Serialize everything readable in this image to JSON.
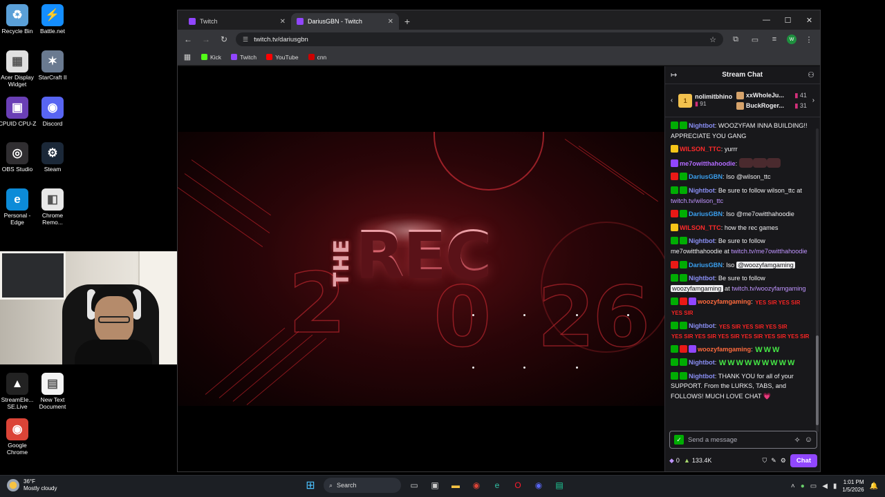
{
  "desktop": {
    "icons": [
      {
        "label": "Recycle Bin",
        "glyph": "♻",
        "color": "#5aa0d8"
      },
      {
        "label": "Battle.net",
        "glyph": "⚡",
        "color": "#148eff"
      },
      {
        "label": "Acer Display Widget",
        "glyph": "▦",
        "color": "#e0e0e0"
      },
      {
        "label": "StarCraft II",
        "glyph": "✶",
        "color": "#6a7a90"
      },
      {
        "label": "CPUID CPU-Z",
        "glyph": "▣",
        "color": "#6a3fb5"
      },
      {
        "label": "Discord",
        "glyph": "◉",
        "color": "#5865f2"
      },
      {
        "label": "OBS Studio",
        "glyph": "◎",
        "color": "#302e31"
      },
      {
        "label": "Steam",
        "glyph": "⚙",
        "color": "#1b2838"
      },
      {
        "label": "Personal - Edge",
        "glyph": "e",
        "color": "#0c8bd8"
      },
      {
        "label": "Chrome Remo...",
        "glyph": "◧",
        "color": "#e8e8e8"
      },
      {
        "label": "StreamEle... SE.Live",
        "glyph": "▲",
        "color": "#222"
      },
      {
        "label": "New Text Document",
        "glyph": "▤",
        "color": "#f4f4f4"
      },
      {
        "label": "Google Chrome",
        "glyph": "◉",
        "color": "#db4437"
      }
    ]
  },
  "browser": {
    "tabs": [
      {
        "label": "Twitch",
        "active": false
      },
      {
        "label": "DariusGBN - Twitch",
        "active": true
      }
    ],
    "url": "twitch.tv/dariusgbn",
    "profile_initial": "W",
    "bookmarks": [
      {
        "label": "Kick",
        "color": "#53fc18"
      },
      {
        "label": "Twitch",
        "color": "#9146ff"
      },
      {
        "label": "YouTube",
        "color": "#ff0000"
      },
      {
        "label": "cnn",
        "color": "#cc0000"
      }
    ]
  },
  "stream": {
    "title_small": "THE",
    "title_big": "REC",
    "year_digits": [
      "2",
      "0",
      "2",
      "6"
    ]
  },
  "chat": {
    "header": "Stream Chat",
    "gifters": {
      "top": {
        "name": "nolimitbhino",
        "count": "91",
        "rank": "1"
      },
      "others": [
        {
          "name": "xxWholeJu...",
          "count": "41"
        },
        {
          "name": "BuckRoger...",
          "count": "31"
        }
      ]
    },
    "messages": [
      {
        "user": "Nightbot",
        "color": "#8a8ff5",
        "badges": [
          "#00ad03",
          "#00ad03"
        ],
        "parts": [
          {
            "t": "text",
            "v": "WOOZYFAM INNA BUILDING!! APPRECIATE YOU GANG"
          }
        ]
      },
      {
        "user": "WILSON_TTC",
        "color": "#ff2a2a",
        "badges": [
          "#f5c518"
        ],
        "parts": [
          {
            "t": "text",
            "v": "yurrr"
          }
        ]
      },
      {
        "user": "me7owitthahoodie",
        "color": "#b36bff",
        "badges": [
          "#9146ff"
        ],
        "parts": [
          {
            "t": "face",
            "v": ""
          },
          {
            "t": "face",
            "v": ""
          },
          {
            "t": "face",
            "v": ""
          }
        ]
      },
      {
        "user": "DariusGBN",
        "color": "#3aa0f0",
        "badges": [
          "#e91916",
          "#00ad03"
        ],
        "parts": [
          {
            "t": "text",
            "v": "Iso @wilson_ttc"
          }
        ]
      },
      {
        "user": "Nightbot",
        "color": "#8a8ff5",
        "badges": [
          "#00ad03",
          "#00ad03"
        ],
        "parts": [
          {
            "t": "text",
            "v": "Be sure to follow wilson_ttc at "
          },
          {
            "t": "link",
            "v": "twitch.tv/wilson_ttc"
          }
        ]
      },
      {
        "user": "DariusGBN",
        "color": "#3aa0f0",
        "badges": [
          "#e91916",
          "#00ad03"
        ],
        "parts": [
          {
            "t": "text",
            "v": "Iso @me7owitthahoodie"
          }
        ]
      },
      {
        "user": "WILSON_TTC",
        "color": "#ff2a2a",
        "badges": [
          "#f5c518"
        ],
        "parts": [
          {
            "t": "text",
            "v": "how the rec games"
          }
        ]
      },
      {
        "user": "Nightbot",
        "color": "#8a8ff5",
        "badges": [
          "#00ad03",
          "#00ad03"
        ],
        "parts": [
          {
            "t": "text",
            "v": "Be sure to follow me7owitthahoodie at "
          },
          {
            "t": "link",
            "v": "twitch.tv/me7owitthahoodie"
          }
        ]
      },
      {
        "user": "DariusGBN",
        "color": "#3aa0f0",
        "badges": [
          "#e91916",
          "#00ad03"
        ],
        "parts": [
          {
            "t": "text",
            "v": "Iso "
          },
          {
            "t": "mention",
            "v": "@woozyfamgaming"
          }
        ]
      },
      {
        "user": "Nightbot",
        "color": "#8a8ff5",
        "badges": [
          "#00ad03",
          "#00ad03"
        ],
        "parts": [
          {
            "t": "text",
            "v": "Be sure to follow "
          },
          {
            "t": "mention",
            "v": "woozyfamgaming"
          },
          {
            "t": "text",
            "v": " at "
          },
          {
            "t": "link",
            "v": "twitch.tv/woozyfamgaming"
          }
        ]
      },
      {
        "user": "woozyfamgaming",
        "color": "#ff6a3d",
        "badges": [
          "#00ad03",
          "#e91916",
          "#9146ff"
        ],
        "parts": [
          {
            "t": "yes",
            "v": "YES SIR"
          },
          {
            "t": "yes",
            "v": "YES SIR"
          },
          {
            "t": "yes",
            "v": "YES SIR"
          }
        ]
      },
      {
        "user": "Nightbot",
        "color": "#8a8ff5",
        "badges": [
          "#00ad03",
          "#00ad03"
        ],
        "parts": [
          {
            "t": "yes",
            "v": "YES SIR"
          },
          {
            "t": "yes",
            "v": "YES SIR"
          },
          {
            "t": "yes",
            "v": "YES SIR"
          },
          {
            "t": "yes",
            "v": "YES SIR"
          },
          {
            "t": "yes",
            "v": "YES SIR"
          },
          {
            "t": "yes",
            "v": "YES SIR"
          },
          {
            "t": "yes",
            "v": "YES SIR"
          },
          {
            "t": "yes",
            "v": "YES SIR"
          },
          {
            "t": "yes",
            "v": "YES SIR"
          }
        ]
      },
      {
        "user": "woozyfamgaming",
        "color": "#ff6a3d",
        "badges": [
          "#00ad03",
          "#e91916",
          "#9146ff"
        ],
        "parts": [
          {
            "t": "w",
            "v": "W"
          },
          {
            "t": "w",
            "v": "W"
          },
          {
            "t": "w",
            "v": "W"
          }
        ]
      },
      {
        "user": "Nightbot",
        "color": "#8a8ff5",
        "badges": [
          "#00ad03",
          "#00ad03"
        ],
        "parts": [
          {
            "t": "w",
            "v": "W"
          },
          {
            "t": "w",
            "v": "W"
          },
          {
            "t": "w",
            "v": "W"
          },
          {
            "t": "w",
            "v": "W"
          },
          {
            "t": "w",
            "v": "W"
          },
          {
            "t": "w",
            "v": "W"
          },
          {
            "t": "w",
            "v": "W"
          },
          {
            "t": "w",
            "v": "W"
          },
          {
            "t": "w",
            "v": "W"
          }
        ]
      },
      {
        "user": "Nightbot",
        "color": "#8a8ff5",
        "badges": [
          "#00ad03",
          "#00ad03"
        ],
        "parts": [
          {
            "t": "text",
            "v": "THANK YOU for all of your SUPPORT. From the LURKS, TABS, and FOLLOWS! MUCH LOVE CHAT 💗"
          }
        ]
      }
    ],
    "input_placeholder": "Send a message",
    "points": "0",
    "bits": "133.4K",
    "chat_button": "Chat"
  },
  "taskbar": {
    "temperature": "36°F",
    "weather": "Mostly cloudy",
    "search_label": "Search",
    "time": "1:01 PM",
    "date": "1/5/2026"
  }
}
